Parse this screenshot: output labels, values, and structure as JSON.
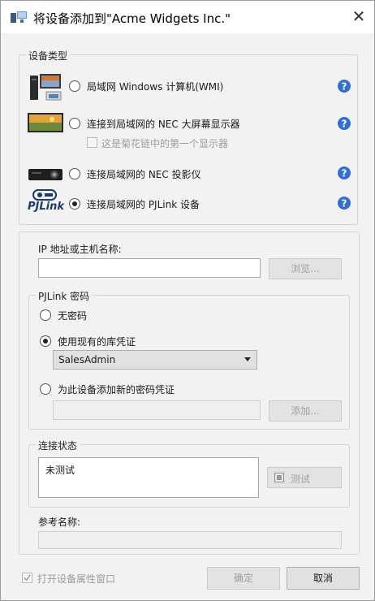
{
  "window": {
    "title": "将设备添加到\"Acme Widgets Inc.\"",
    "close_symbol": "✕"
  },
  "device_type": {
    "legend": "设备类型",
    "options": [
      {
        "label": "局域网 Windows 计算机(WMI)",
        "icon": "computer-monitor-icon",
        "selected": false
      },
      {
        "label": "连接到局域网的 NEC 大屏幕显示器",
        "icon": "large-display-icon",
        "selected": false
      },
      {
        "label": "连接局域网的 NEC 投影仪",
        "icon": "projector-icon",
        "selected": false
      },
      {
        "label": "连接局域网的 PJLink 设备",
        "icon": "pjlink-icon",
        "selected": true
      }
    ],
    "daisy_chain_label": "这是菊花链中的第一个显示器",
    "pjlink_logo_text": "PJLink",
    "help_symbol": "?"
  },
  "ip": {
    "label": "IP 地址或主机名称:",
    "value": "",
    "browse_label": "浏览..."
  },
  "pjlink_password": {
    "legend": "PJLink 密码",
    "no_password_label": "无密码",
    "use_existing_label": "使用现有的库凭证",
    "selected_credential": "SalesAdmin",
    "add_new_label": "为此设备添加新的密码凭证",
    "new_credential_value": "",
    "add_button_label": "添加..."
  },
  "connection_status": {
    "legend": "连接状态",
    "status_text": "未测试",
    "test_button_label": "测试"
  },
  "reference_name": {
    "label": "参考名称:",
    "value": ""
  },
  "footer": {
    "open_properties_label": "打开设备属性窗口",
    "open_properties_checked": true,
    "ok_label": "确定",
    "cancel_label": "取消"
  },
  "colors": {
    "help_blue": "#2f6fd6",
    "window_bg": "#f2f2f2",
    "titlebar_bg": "#ffffff"
  }
}
